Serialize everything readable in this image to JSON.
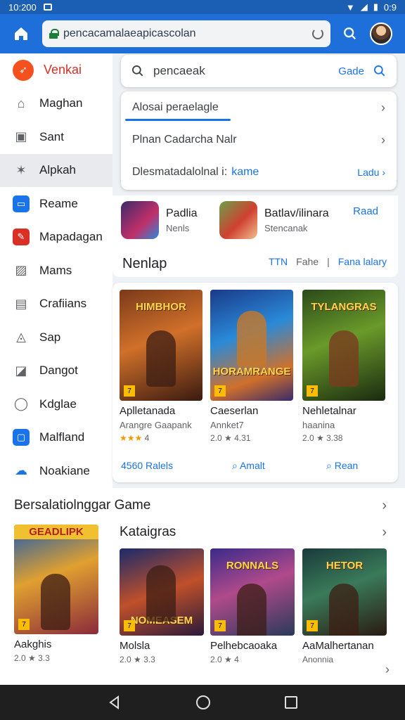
{
  "status": {
    "time": "10:200",
    "right": "0:9"
  },
  "browser": {
    "url": "pencacamalaeapicascolan"
  },
  "sidebar": {
    "items": [
      {
        "label": "Venkai",
        "icon": "app-logo-icon"
      },
      {
        "label": "Maghan",
        "icon": "home-icon"
      },
      {
        "label": "Sant",
        "icon": "calendar-icon"
      },
      {
        "label": "Alpkah",
        "icon": "puzzle-icon"
      },
      {
        "label": "Reame",
        "icon": "card-icon"
      },
      {
        "label": "Mapadagan",
        "icon": "edit-icon"
      },
      {
        "label": "Mams",
        "icon": "image-icon"
      },
      {
        "label": "Crafiians",
        "icon": "grid-icon"
      },
      {
        "label": "Sap",
        "icon": "bag-icon"
      },
      {
        "label": "Dangot",
        "icon": "tag-icon"
      },
      {
        "label": "Kdglae",
        "icon": "circle-icon"
      },
      {
        "label": "Malfland",
        "icon": "folder-icon"
      },
      {
        "label": "Noakiane",
        "icon": "cloud-icon"
      }
    ]
  },
  "search": {
    "query": "pencaeak",
    "action": "Gade"
  },
  "suggestions": [
    {
      "label": "Alosai peraelagle"
    },
    {
      "label": "Plnan Cadarcha Nalr"
    },
    {
      "label": "Dlesmatadalolnal i:",
      "highlight": "kame",
      "more": "Ladu"
    }
  ],
  "featured": {
    "apps": [
      {
        "name": "Padlia",
        "sub": "Nenls"
      },
      {
        "name": "Batlav/ilinara",
        "sub": "Stencanak"
      }
    ],
    "action": "Raad",
    "section_title": "Nenlap",
    "links": [
      "TTN",
      "Fahe",
      "Fana lalary"
    ]
  },
  "games": [
    {
      "art_title": "HIMBHOR",
      "name": "Aplletanada",
      "dev": "Arangre Gaapank",
      "rating": "★★★",
      "rating_text": "4"
    },
    {
      "art_title": "HORAMRANGE",
      "name": "Caeserlan",
      "dev": "Annket7",
      "rating": "",
      "rating_text": "2.0 ★ 4.31"
    },
    {
      "art_title": "TYLANGRAS",
      "name": "Nehletalnar",
      "dev": "haanina",
      "rating": "",
      "rating_text": "2.0 ★ 3.38"
    }
  ],
  "games_footer": [
    "4560 Ralels",
    "Amalt",
    "Rean"
  ],
  "bottom": {
    "title": "Bersalatiolnggar Game",
    "subtitle": "Kataigras",
    "games": [
      {
        "art_title": "GEADLIPK",
        "name": "Aakghis",
        "rating_text": "2.0 ★ 3.3"
      },
      {
        "art_title": "NOMEASEM",
        "name": "Molsla",
        "rating_text": "2.0 ★ 3.3"
      },
      {
        "art_title": "RONNALS",
        "name": "Pelhebcaoaka",
        "rating_text": "2.0 ★ 4"
      },
      {
        "art_title": "HETOR",
        "name": "AaMalhertanan",
        "rating_text": "Anonnia"
      }
    ]
  },
  "colors": {
    "accent": "#1a73e8",
    "header": "#1e6fd9",
    "brand": "#d93025"
  }
}
